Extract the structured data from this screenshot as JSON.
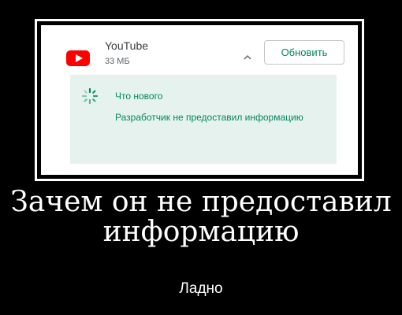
{
  "app": {
    "icon": "youtube-logo-icon",
    "name": "YouTube",
    "size": "33 МБ",
    "expand_icon": "chevron-up-icon",
    "update_label": "Обновить"
  },
  "whats_new": {
    "icon": "loading-spinner-icon",
    "title": "Что нового",
    "body": "Разработчик не предоставил информацию"
  },
  "caption": {
    "title": "Зачем он не предоставил информацию",
    "subtitle": "Ладно"
  },
  "colors": {
    "accent": "#01875f",
    "panel_bg": "#e6f2ee",
    "youtube_red": "#ff0000"
  }
}
